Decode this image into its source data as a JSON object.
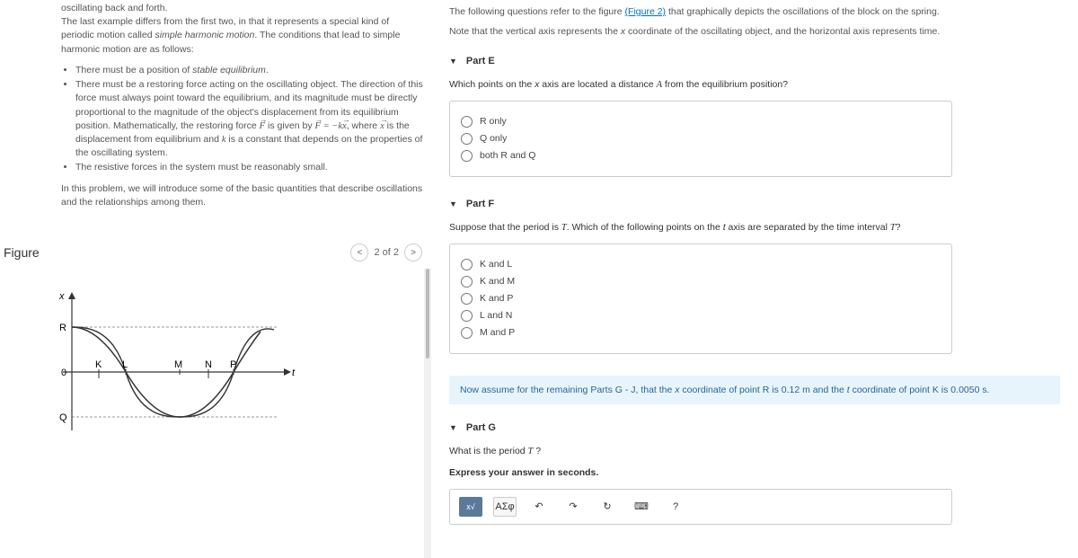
{
  "intro": {
    "p1": "oscillating back and forth.",
    "p2_a": "The last example differs from the first two, in that it represents a special kind of periodic motion called ",
    "p2_em": "simple harmonic motion",
    "p2_b": ". The conditions that lead to simple harmonic motion are as follows:",
    "b1_a": "There must be a position of ",
    "b1_em": "stable equilibrium",
    "b1_b": ".",
    "b2_a": "There must be a restoring force acting on the oscillating object. The direction of this force must always point toward the equilibrium, and its magnitude must be directly proportional to the magnitude of the object's displacement from its equilibrium position. Mathematically, the restoring force ",
    "b2_b": " is given by ",
    "b2_c": ", where ",
    "b2_d": " is the displacement from equilibrium and ",
    "b2_e": " is a constant that depends on the properties of the oscillating system.",
    "b3": "The resistive forces in the system must be reasonably small.",
    "closing": "In this problem, we will introduce some of the basic quantities that describe oscillations and the relationships among them."
  },
  "figure": {
    "title": "Figure",
    "pager": "2 of 2",
    "axis_x": "x",
    "axis_t": "t",
    "R": "R",
    "Q": "Q",
    "zero": "0",
    "K": "K",
    "L": "L",
    "M": "M",
    "N": "N",
    "P": "P"
  },
  "top": {
    "a": "The following questions refer to the figure ",
    "link": "(Figure 2)",
    "b": " that graphically depicts the oscillations of the block on the spring.",
    "note_a": "Note that the vertical axis represents the ",
    "note_var": "x",
    "note_b": " coordinate of the oscillating object, and the horizontal axis represents time."
  },
  "partE": {
    "title": "Part E",
    "q_a": "Which points on the ",
    "q_var1": "x",
    "q_b": " axis are located a distance ",
    "q_var2": "A",
    "q_c": " from the equilibrium position?",
    "o1": "R only",
    "o2": "Q only",
    "o3": "both R and Q"
  },
  "partF": {
    "title": "Part F",
    "q_a": "Suppose that the period is ",
    "q_T": "T",
    "q_b": ". Which of the following points on the ",
    "q_var": "t",
    "q_c": " axis are separated by the time interval ",
    "q_d": "?",
    "o1": "K and L",
    "o2": "K and M",
    "o3": "K and P",
    "o4": "L and N",
    "o5": "M and P"
  },
  "banner": {
    "a": "Now assume for the remaining Parts G - J, that the ",
    "x": "x",
    "b": " coordinate of point R is 0.12 ",
    "unit_m": "m",
    "c": " and the ",
    "t": "t",
    "d": " coordinate of point K is 0.0050 ",
    "unit_s": "s",
    "e": "."
  },
  "partG": {
    "title": "Part G",
    "q_a": "What is the period ",
    "q_T": "T",
    "q_b": " ?",
    "sub": "Express your answer in seconds.",
    "tool_asig": "ΑΣφ",
    "tool_q": "?"
  }
}
